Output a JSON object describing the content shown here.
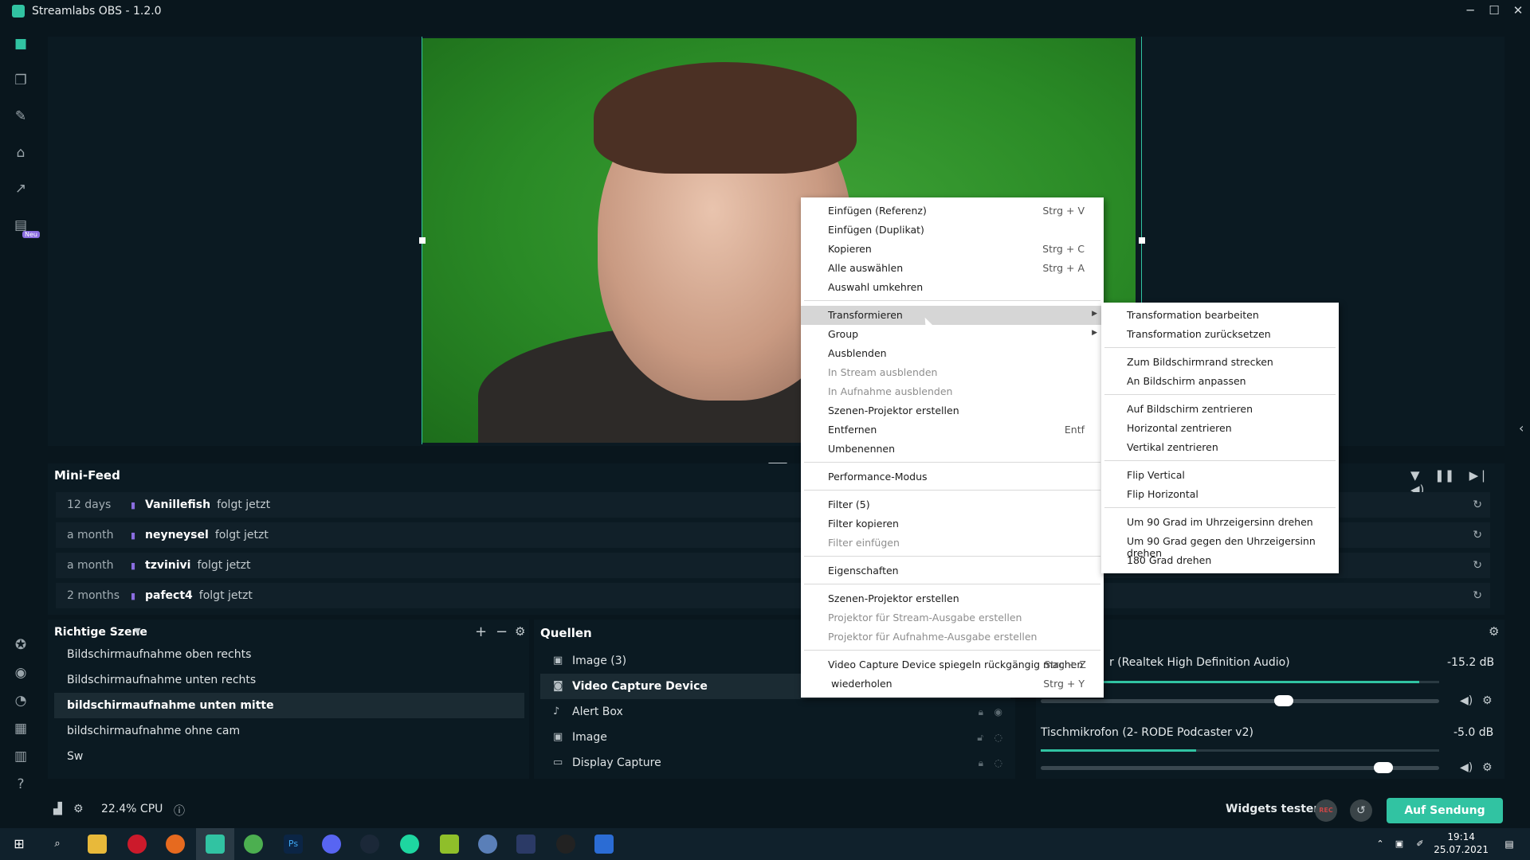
{
  "window": {
    "title": "Streamlabs OBS - 1.2.0",
    "controls": [
      "─",
      "☐",
      "✕"
    ]
  },
  "leftnav": {
    "badge": "Neu"
  },
  "minifeed": {
    "title": "Mini-Feed",
    "rows": [
      {
        "age": "12 days",
        "user": "Vanillefish",
        "action": "folgt jetzt"
      },
      {
        "age": "a month",
        "user": "neyneysel",
        "action": "folgt jetzt"
      },
      {
        "age": "a month",
        "user": "tzvinivi",
        "action": "folgt jetzt"
      },
      {
        "age": "2 months",
        "user": "pafect4",
        "action": "folgt jetzt"
      }
    ]
  },
  "scenes": {
    "title": "Richtige Szene",
    "items": [
      {
        "label": "Bildschirmaufnahme oben rechts"
      },
      {
        "label": "Bildschirmaufnahme unten rechts"
      },
      {
        "label": "bildschirmaufnahme unten mitte"
      },
      {
        "label": "bildschirmaufnahme ohne cam"
      },
      {
        "label": "Sw"
      }
    ]
  },
  "sources": {
    "title": "Quellen",
    "items": [
      {
        "label": "Image (3)",
        "icon": "image-icon"
      },
      {
        "label": "Video Capture Device",
        "icon": "camera-icon"
      },
      {
        "label": "Alert Box",
        "icon": "bell-icon"
      },
      {
        "label": "Image",
        "icon": "image-icon"
      },
      {
        "label": "Display Capture",
        "icon": "monitor-icon"
      }
    ]
  },
  "mixer": {
    "channels": [
      {
        "name": "r (Realtek High Definition Audio)",
        "db": "-15.2 dB",
        "level": 0.95,
        "volume": 0.61
      },
      {
        "name": "Tischmikrofon (2- RODE Podcaster v2)",
        "db": "-5.0 dB",
        "level": 0.39,
        "volume": 0.86
      }
    ]
  },
  "footer": {
    "cpu": "22.4% CPU",
    "widgets_label": "Widgets testen",
    "rec_label": "REC",
    "golive_label": "Auf Sendung gehen"
  },
  "taskbar": {
    "time": "19:14",
    "date": "25.07.2021"
  },
  "context_menu": {
    "items": [
      {
        "label": "Einfügen (Referenz)",
        "shortcut": "Strg + V"
      },
      {
        "label": "Einfügen (Duplikat)",
        "shortcut": ""
      },
      {
        "label": "Kopieren",
        "shortcut": "Strg + C"
      },
      {
        "label": "Alle auswählen",
        "shortcut": "Strg + A"
      },
      {
        "label": "Auswahl umkehren",
        "shortcut": ""
      },
      {
        "label": "Transformieren",
        "shortcut": ""
      },
      {
        "label": "Group",
        "shortcut": ""
      },
      {
        "label": "Ausblenden",
        "shortcut": ""
      },
      {
        "label": "In Stream ausblenden",
        "shortcut": ""
      },
      {
        "label": "In Aufnahme ausblenden",
        "shortcut": ""
      },
      {
        "label": "Szenen-Projektor erstellen",
        "shortcut": ""
      },
      {
        "label": "Entfernen",
        "shortcut": "Entf"
      },
      {
        "label": "Umbenennen",
        "shortcut": ""
      },
      {
        "label": "Performance-Modus",
        "shortcut": ""
      },
      {
        "label": "Filter (5)",
        "shortcut": ""
      },
      {
        "label": "Filter kopieren",
        "shortcut": ""
      },
      {
        "label": "Filter einfügen",
        "shortcut": ""
      },
      {
        "label": "Eigenschaften",
        "shortcut": ""
      },
      {
        "label": "Szenen-Projektor erstellen",
        "shortcut": ""
      },
      {
        "label": "Projektor für Stream-Ausgabe erstellen",
        "shortcut": ""
      },
      {
        "label": "Projektor für Aufnahme-Ausgabe erstellen",
        "shortcut": ""
      },
      {
        "label": "Video Capture Device spiegeln rückgängig machen",
        "shortcut": "Strg + Z"
      },
      {
        "label": "wiederholen",
        "shortcut": "Strg + Y"
      }
    ]
  },
  "transform_submenu": {
    "items": [
      {
        "label": "Transformation bearbeiten"
      },
      {
        "label": "Transformation zurücksetzen"
      },
      {
        "label": "Zum Bildschirmrand strecken"
      },
      {
        "label": "An Bildschirm anpassen"
      },
      {
        "label": "Auf Bildschirm zentrieren"
      },
      {
        "label": "Horizontal zentrieren"
      },
      {
        "label": "Vertikal zentrieren"
      },
      {
        "label": "Flip Vertical"
      },
      {
        "label": "Flip Horizontal"
      },
      {
        "label": "Um 90 Grad im Uhrzeigersinn drehen"
      },
      {
        "label": "Um 90 Grad gegen den Uhrzeigersinn drehen"
      },
      {
        "label": "180 Grad drehen"
      }
    ]
  },
  "colors": {
    "accent": "#31c3a2",
    "background": "#09161d",
    "panel": "#0b1a22",
    "twitch": "#8a6de0"
  }
}
